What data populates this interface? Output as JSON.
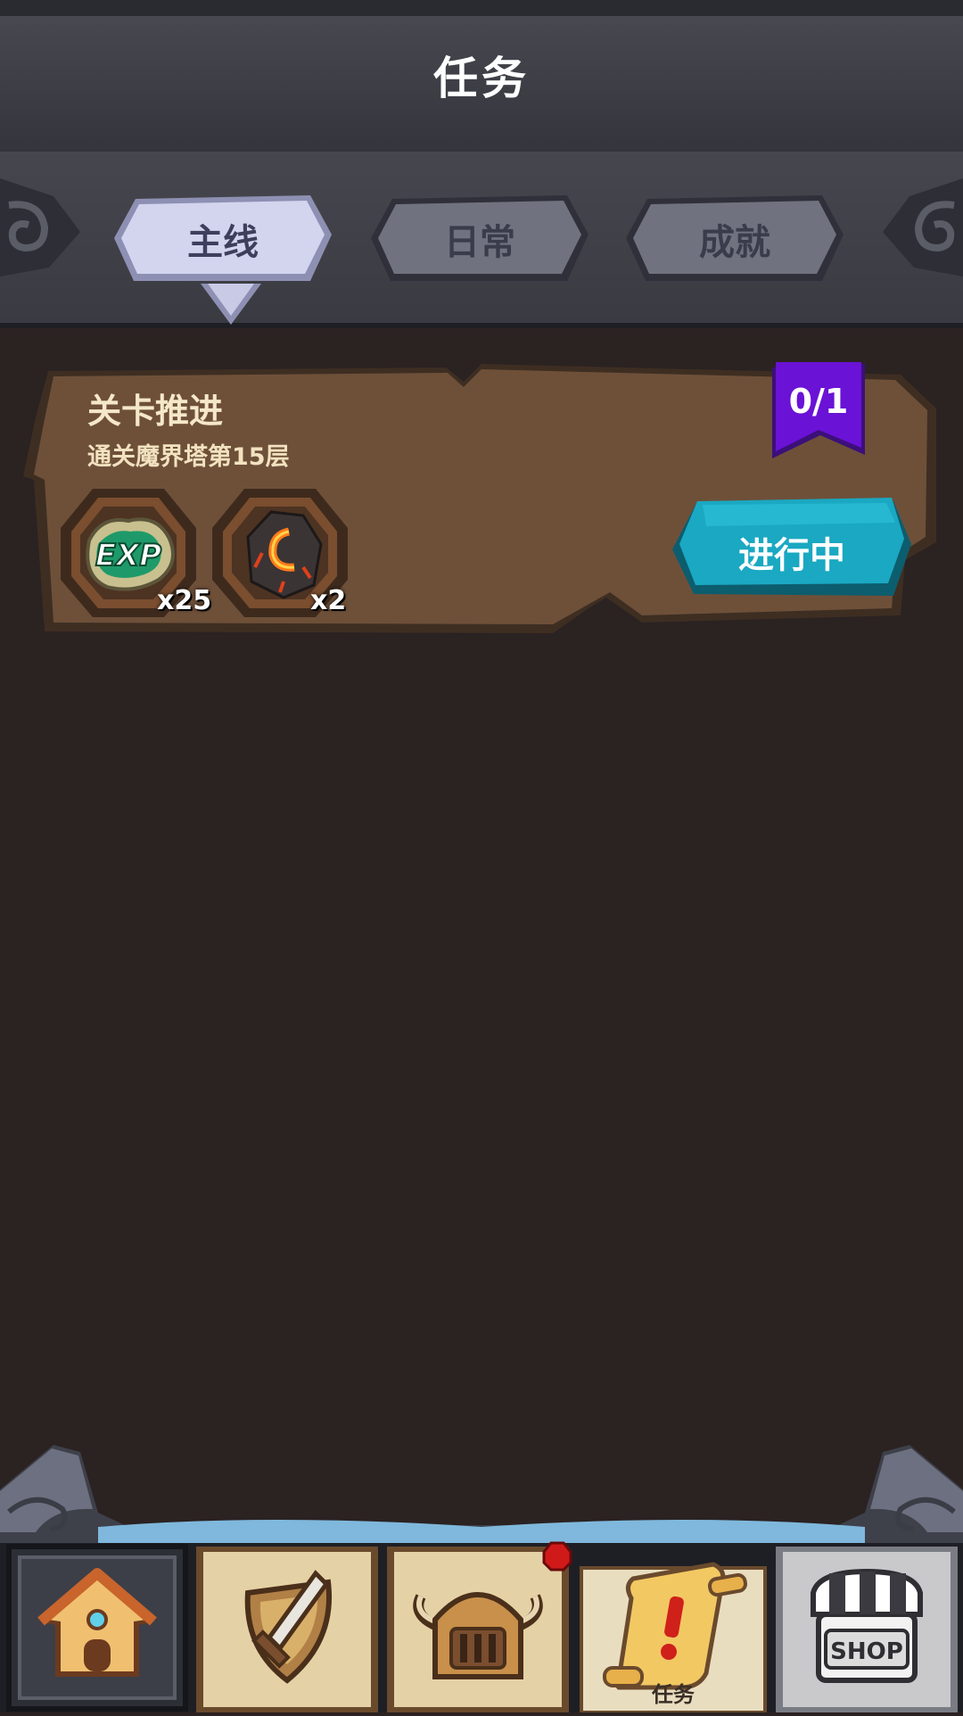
{
  "header": {
    "title": "任务"
  },
  "tabs": [
    {
      "label": "主线",
      "active": true
    },
    {
      "label": "日常",
      "active": false
    },
    {
      "label": "成就",
      "active": false
    }
  ],
  "quest": {
    "title": "关卡推进",
    "description": "通关魔界塔第15层",
    "progress": "0/1",
    "rewards": [
      {
        "icon": "exp-icon",
        "label": "EXP",
        "count": "x25"
      },
      {
        "icon": "lava-stone-icon",
        "count": "x2"
      }
    ],
    "status_button": "进行中"
  },
  "nav": {
    "items": [
      {
        "icon": "home-icon"
      },
      {
        "icon": "sword-shield-icon"
      },
      {
        "icon": "helmet-icon",
        "badge": true
      },
      {
        "icon": "quest-scroll-icon",
        "label": "任务",
        "active": true
      },
      {
        "icon": "shop-icon",
        "label": "SHOP"
      }
    ]
  },
  "colors": {
    "background": "#2b2222",
    "card": "#6b4e36",
    "flag": "#6a0fd1",
    "status_button": "#1aa8c2",
    "tab_active": "#c9cbe6",
    "tab_inactive": "#6e7080"
  }
}
